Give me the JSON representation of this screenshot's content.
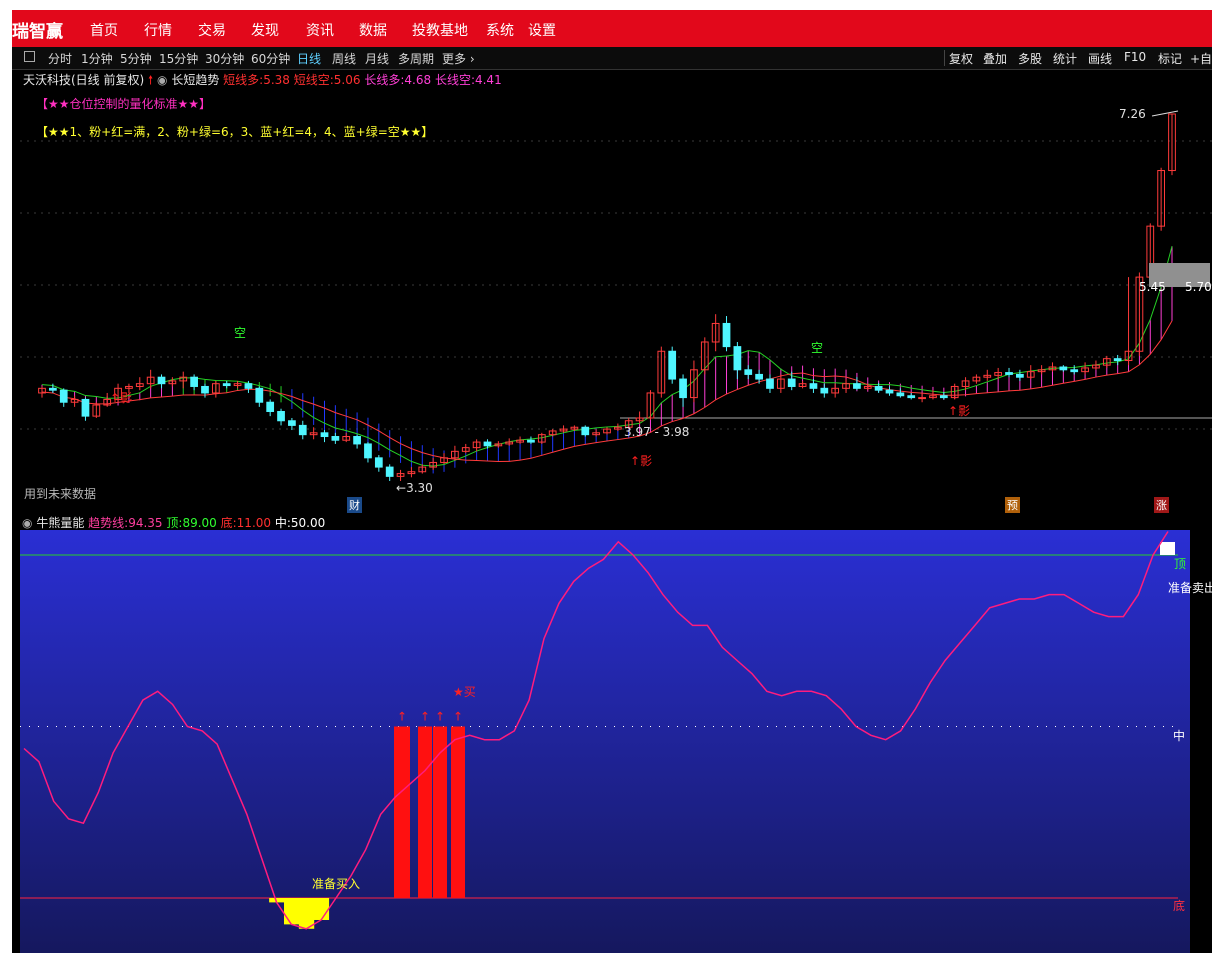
{
  "app": {
    "brand": "瑞智赢"
  },
  "menu": [
    "首页",
    "行情",
    "交易",
    "发现",
    "资讯",
    "数据",
    "投教基地",
    "系统",
    "设置"
  ],
  "periods": {
    "items": [
      "分时",
      "1分钟",
      "5分钟",
      "15分钟",
      "30分钟",
      "60分钟",
      "日线",
      "周线",
      "月线",
      "多周期",
      "更多"
    ],
    "active": "日线"
  },
  "tools": [
    "复权",
    "叠加",
    "多股",
    "统计",
    "画线",
    "F10",
    "标记",
    "+自选"
  ],
  "chart_header": {
    "stock": "天沃科技(日线 前复权)",
    "indicator": "长短趋势",
    "short_long_label": "短线多:",
    "short_long_value": "5.38",
    "short_short_label": "短线空:",
    "short_short_value": "5.06",
    "long_long_label": "长线多:",
    "long_long_value": "4.68",
    "long_short_label": "长线空:",
    "long_short_value": "4.41"
  },
  "notes": {
    "title": "【★★仓位控制的量化标准★★】",
    "rules": "【★★1、粉+红=满，2、粉+绿=6，3、蓝+红=4，4、蓝+绿=空★★】",
    "future_data": "用到未来数据"
  },
  "annotations": {
    "high": "7.26",
    "low": "3.30",
    "box_left": "5.45",
    "box_right": "5.70",
    "range_label": "3.97 - 3.98",
    "kong": "空",
    "ying": "影"
  },
  "markers": {
    "cai": "财",
    "yu": "预",
    "zhang": "涨"
  },
  "lower_header": {
    "name": "牛熊量能",
    "trend_label": "趋势线:",
    "trend_value": "94.35",
    "top_label": "顶:",
    "top_value": "89.00",
    "bottom_label": "底:",
    "bottom_value": "11.00",
    "mid_label": "中:",
    "mid_value": "50.00"
  },
  "lower_labels": {
    "top": "顶",
    "mid": "中",
    "bottom": "底",
    "prepare_buy": "准备买入",
    "prepare_sell": "准备卖出",
    "star_buy": "★买"
  },
  "colors": {
    "brand_red": "#e2081b",
    "up": "#ff3b3b",
    "down": "#4ff5ff",
    "green_band": "#25d125",
    "blue_band": "#2038ff",
    "pink_band": "#ff3fd6",
    "trend_line": "#ff1c7e",
    "yellow_fill": "#ffff00",
    "panel_blue_top": "#2a2fd4",
    "panel_blue_bottom": "#15185e"
  },
  "chart_data": [
    {
      "type": "candlestick",
      "title": "天沃科技(日线 前复权)",
      "y_range": [
        3.3,
        7.26
      ],
      "candles": [
        [
          4.25,
          4.3,
          4.2,
          4.32
        ],
        [
          4.3,
          4.28,
          4.25,
          4.35
        ],
        [
          4.28,
          4.15,
          4.1,
          4.3
        ],
        [
          4.15,
          4.18,
          4.1,
          4.22
        ],
        [
          4.18,
          4.0,
          3.95,
          4.2
        ],
        [
          4.0,
          4.12,
          3.98,
          4.15
        ],
        [
          4.12,
          4.18,
          4.1,
          4.25
        ],
        [
          4.18,
          4.3,
          4.15,
          4.35
        ],
        [
          4.3,
          4.32,
          4.25,
          4.35
        ],
        [
          4.32,
          4.35,
          4.28,
          4.42
        ],
        [
          4.35,
          4.42,
          4.3,
          4.5
        ],
        [
          4.42,
          4.35,
          4.3,
          4.45
        ],
        [
          4.35,
          4.38,
          4.32,
          4.42
        ],
        [
          4.38,
          4.42,
          4.3,
          4.48
        ],
        [
          4.42,
          4.32,
          4.28,
          4.45
        ],
        [
          4.32,
          4.25,
          4.2,
          4.35
        ],
        [
          4.25,
          4.35,
          4.2,
          4.38
        ],
        [
          4.35,
          4.33,
          4.3,
          4.38
        ],
        [
          4.33,
          4.35,
          4.3,
          4.38
        ],
        [
          4.35,
          4.3,
          4.25,
          4.38
        ],
        [
          4.3,
          4.15,
          4.1,
          4.32
        ],
        [
          4.15,
          4.05,
          4.0,
          4.18
        ],
        [
          4.05,
          3.95,
          3.9,
          4.08
        ],
        [
          3.95,
          3.9,
          3.85,
          3.98
        ],
        [
          3.9,
          3.8,
          3.75,
          3.95
        ],
        [
          3.8,
          3.82,
          3.75,
          3.88
        ],
        [
          3.82,
          3.78,
          3.72,
          3.85
        ],
        [
          3.78,
          3.74,
          3.7,
          3.82
        ],
        [
          3.74,
          3.78,
          3.72,
          3.82
        ],
        [
          3.78,
          3.7,
          3.65,
          3.8
        ],
        [
          3.7,
          3.55,
          3.5,
          3.72
        ],
        [
          3.55,
          3.45,
          3.4,
          3.58
        ],
        [
          3.45,
          3.35,
          3.3,
          3.48
        ],
        [
          3.35,
          3.38,
          3.3,
          3.42
        ],
        [
          3.38,
          3.4,
          3.34,
          3.45
        ],
        [
          3.4,
          3.45,
          3.38,
          3.48
        ],
        [
          3.45,
          3.5,
          3.42,
          3.55
        ],
        [
          3.5,
          3.55,
          3.48,
          3.6
        ],
        [
          3.55,
          3.62,
          3.52,
          3.68
        ],
        [
          3.62,
          3.66,
          3.6,
          3.7
        ],
        [
          3.66,
          3.72,
          3.62,
          3.75
        ],
        [
          3.72,
          3.68,
          3.65,
          3.75
        ],
        [
          3.68,
          3.7,
          3.66,
          3.73
        ],
        [
          3.7,
          3.72,
          3.68,
          3.76
        ],
        [
          3.72,
          3.74,
          3.7,
          3.78
        ],
        [
          3.74,
          3.72,
          3.7,
          3.78
        ],
        [
          3.72,
          3.8,
          3.7,
          3.82
        ],
        [
          3.8,
          3.84,
          3.78,
          3.86
        ],
        [
          3.84,
          3.86,
          3.82,
          3.9
        ],
        [
          3.86,
          3.88,
          3.84,
          3.9
        ],
        [
          3.88,
          3.8,
          3.78,
          3.9
        ],
        [
          3.8,
          3.82,
          3.78,
          3.86
        ],
        [
          3.82,
          3.86,
          3.8,
          3.88
        ],
        [
          3.86,
          3.88,
          3.84,
          3.92
        ],
        [
          3.88,
          3.95,
          3.86,
          3.98
        ],
        [
          3.95,
          3.98,
          3.92,
          4.05
        ],
        [
          3.98,
          4.25,
          3.96,
          4.28
        ],
        [
          4.25,
          4.7,
          4.2,
          4.75
        ],
        [
          4.7,
          4.4,
          4.35,
          4.75
        ],
        [
          4.4,
          4.2,
          4.1,
          4.45
        ],
        [
          4.2,
          4.5,
          4.15,
          4.6
        ],
        [
          4.5,
          4.8,
          4.45,
          4.85
        ],
        [
          4.8,
          5.0,
          4.7,
          5.1
        ],
        [
          5.0,
          4.75,
          4.7,
          5.08
        ],
        [
          4.75,
          4.5,
          4.4,
          4.8
        ],
        [
          4.5,
          4.45,
          4.4,
          4.55
        ],
        [
          4.45,
          4.4,
          4.35,
          4.5
        ],
        [
          4.4,
          4.3,
          4.25,
          4.45
        ],
        [
          4.3,
          4.4,
          4.25,
          4.45
        ],
        [
          4.4,
          4.32,
          4.28,
          4.48
        ],
        [
          4.32,
          4.35,
          4.3,
          4.38
        ],
        [
          4.35,
          4.3,
          4.25,
          4.4
        ],
        [
          4.3,
          4.25,
          4.2,
          4.35
        ],
        [
          4.25,
          4.3,
          4.2,
          4.35
        ],
        [
          4.3,
          4.35,
          4.25,
          4.4
        ],
        [
          4.35,
          4.3,
          4.28,
          4.42
        ],
        [
          4.3,
          4.32,
          4.28,
          4.35
        ],
        [
          4.32,
          4.28,
          4.25,
          4.36
        ],
        [
          4.28,
          4.25,
          4.22,
          4.32
        ],
        [
          4.25,
          4.22,
          4.2,
          4.3
        ],
        [
          4.22,
          4.2,
          4.18,
          4.25
        ],
        [
          4.2,
          4.2,
          4.15,
          4.25
        ],
        [
          4.2,
          4.22,
          4.18,
          4.28
        ],
        [
          4.22,
          4.2,
          4.18,
          4.26
        ],
        [
          4.2,
          4.32,
          4.18,
          4.35
        ],
        [
          4.32,
          4.38,
          4.28,
          4.42
        ],
        [
          4.38,
          4.42,
          4.35,
          4.45
        ],
        [
          4.42,
          4.44,
          4.38,
          4.5
        ],
        [
          4.44,
          4.47,
          4.4,
          4.52
        ],
        [
          4.47,
          4.45,
          4.42,
          4.52
        ],
        [
          4.45,
          4.42,
          4.38,
          4.5
        ],
        [
          4.42,
          4.48,
          4.4,
          4.55
        ],
        [
          4.48,
          4.5,
          4.45,
          4.55
        ],
        [
          4.5,
          4.53,
          4.48,
          4.58
        ],
        [
          4.53,
          4.5,
          4.48,
          4.55
        ],
        [
          4.5,
          4.48,
          4.45,
          4.55
        ],
        [
          4.48,
          4.52,
          4.45,
          4.58
        ],
        [
          4.52,
          4.55,
          4.5,
          4.6
        ],
        [
          4.55,
          4.62,
          4.52,
          4.65
        ],
        [
          4.62,
          4.6,
          4.55,
          4.66
        ],
        [
          4.6,
          4.7,
          4.55,
          5.5
        ],
        [
          4.7,
          5.5,
          4.65,
          5.55
        ],
        [
          5.5,
          6.05,
          5.45,
          6.08
        ],
        [
          6.05,
          6.65,
          6.0,
          6.68
        ],
        [
          6.65,
          7.26,
          6.6,
          7.26
        ]
      ]
    },
    {
      "type": "line",
      "title": "牛熊量能",
      "y_range": [
        0,
        100
      ],
      "series": [
        {
          "name": "趋势线",
          "values": [
            45,
            42,
            33,
            29,
            28,
            35,
            44,
            50,
            56,
            58,
            55,
            50,
            49,
            46,
            38,
            30,
            20,
            10,
            5,
            4,
            6,
            11,
            16,
            22,
            30,
            34,
            37,
            40,
            44,
            47,
            48,
            47,
            47,
            49,
            56,
            70,
            78,
            83,
            86,
            88,
            92,
            89,
            85,
            80,
            76,
            73,
            73,
            68,
            65,
            62,
            58,
            57,
            58,
            58,
            57,
            54,
            50,
            48,
            47,
            49,
            54,
            60,
            65,
            69,
            73,
            77,
            78,
            79,
            79,
            80,
            80,
            78,
            76,
            75,
            75,
            80,
            89,
            94.35
          ]
        }
      ],
      "reference_lines": [
        {
          "label": "顶",
          "value": 89
        },
        {
          "label": "中",
          "value": 50
        },
        {
          "label": "底",
          "value": 11
        }
      ]
    }
  ]
}
